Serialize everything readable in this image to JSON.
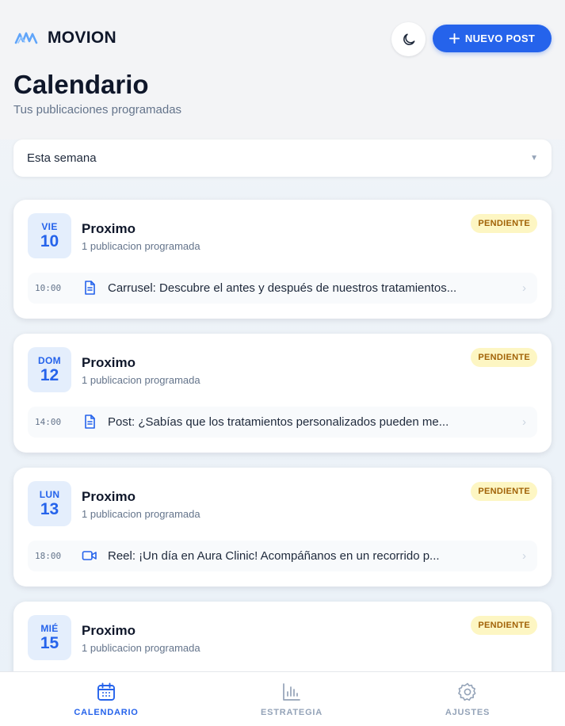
{
  "header": {
    "brand_name": "MOVION",
    "new_post_label": "NUEVO POST",
    "title": "Calendario",
    "subtitle": "Tus publicaciones programadas"
  },
  "filter": {
    "value": "Esta semana"
  },
  "cards": [
    {
      "dow": "VIE",
      "day": "10",
      "title": "Proximo",
      "sub": "1 publicacion programada",
      "status": "PENDIENTE",
      "post": {
        "time": "10:00",
        "type_icon": "document-icon",
        "text": "Carrusel: Descubre el antes y después de nuestros tratamientos..."
      }
    },
    {
      "dow": "DOM",
      "day": "12",
      "title": "Proximo",
      "sub": "1 publicacion programada",
      "status": "PENDIENTE",
      "post": {
        "time": "14:00",
        "type_icon": "document-icon",
        "text": "Post: ¿Sabías que los tratamientos personalizados pueden me..."
      }
    },
    {
      "dow": "LUN",
      "day": "13",
      "title": "Proximo",
      "sub": "1 publicacion programada",
      "status": "PENDIENTE",
      "post": {
        "time": "18:00",
        "type_icon": "video-icon",
        "text": "Reel: ¡Un día en Aura Clinic! Acompáñanos en un recorrido p..."
      }
    },
    {
      "dow": "MIÉ",
      "day": "15",
      "title": "Proximo",
      "sub": "1 publicacion programada",
      "status": "PENDIENTE"
    }
  ],
  "nav": {
    "calendar": "CALENDARIO",
    "strategy": "ESTRATEGIA",
    "settings": "AJUSTES"
  },
  "colors": {
    "accent": "#2563eb",
    "pending_bg": "#fdf6c3",
    "pending_text": "#a16207"
  }
}
